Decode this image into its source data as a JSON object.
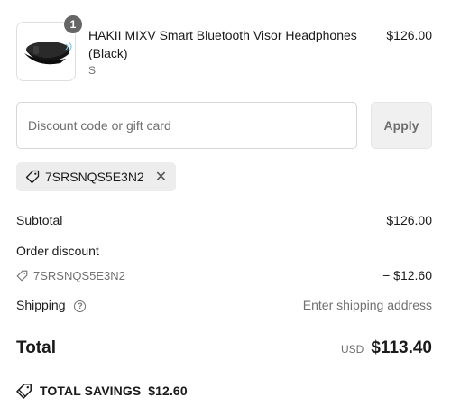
{
  "product": {
    "quantity": "1",
    "name": "HAKII MIXV Smart Bluetooth Visor Headphones (Black)",
    "variant": "S",
    "price": "$126.00",
    "image_icon": "visor-headphones-image"
  },
  "discount": {
    "placeholder": "Discount code or gift card",
    "apply_label": "Apply",
    "applied_code": "7SRSNQS5E3N2"
  },
  "summary": {
    "subtotal_label": "Subtotal",
    "subtotal_value": "$126.00",
    "order_discount_label": "Order discount",
    "discount_code": "7SRSNQS5E3N2",
    "discount_value": "− $12.60",
    "shipping_label": "Shipping",
    "shipping_value": "Enter shipping address",
    "total_label": "Total",
    "currency": "USD",
    "total_value": "$113.40",
    "savings_label": "TOTAL SAVINGS",
    "savings_value": "$12.60"
  },
  "colors": {
    "badge": "#666666",
    "apply_button_bg": "#f0f0f0",
    "chip_bg": "#ededed",
    "muted_text": "#707070"
  }
}
